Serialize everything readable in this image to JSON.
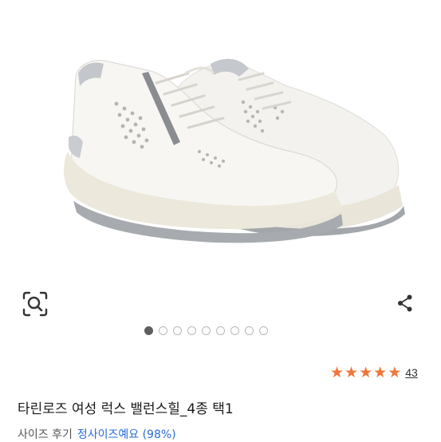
{
  "product": {
    "image": {
      "subject": "white platform sneakers pair"
    },
    "icons": {
      "lens": "image-search-icon",
      "share": "share-icon"
    },
    "carousel": {
      "active_index": 0,
      "total": 9
    },
    "rating": {
      "stars": 5,
      "count": "43",
      "star_color": "#f0763a"
    },
    "title": "타린로즈 여성 럭스 밸런스힐_4종 택1",
    "size_review": {
      "label": "사이즈 후기",
      "value": "정사이즈예요 (98%)",
      "value_color": "#2a6cd6"
    }
  }
}
